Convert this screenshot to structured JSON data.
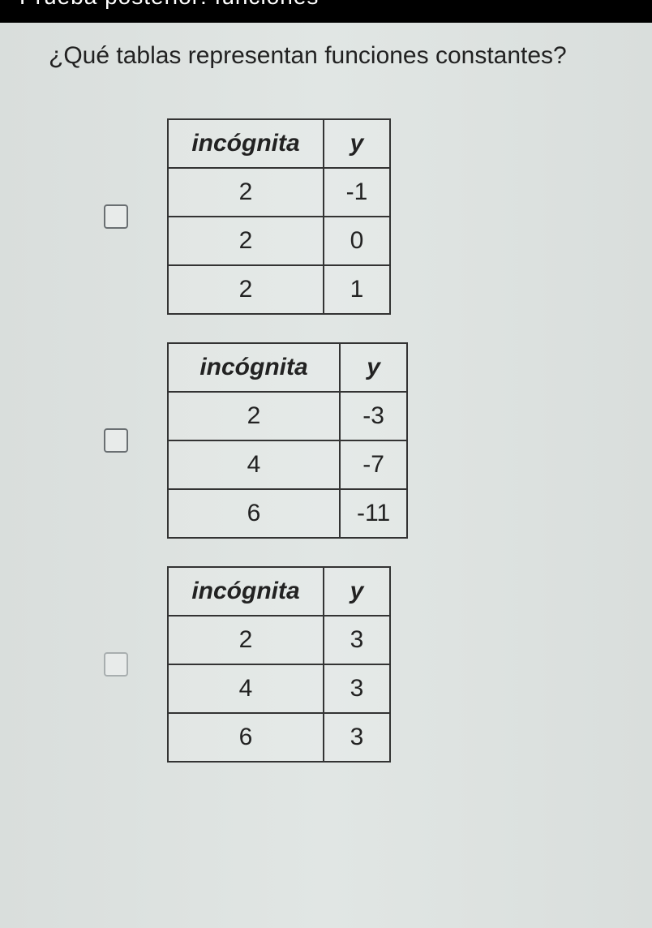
{
  "titlebar_partial": "Prueba posterior: funciones",
  "question": "¿Qué tablas representan funciones constantes?",
  "xheader": "incógnita",
  "yheader": "y",
  "tables": [
    {
      "rows": [
        {
          "x": "2",
          "y": "-1"
        },
        {
          "x": "2",
          "y": "0"
        },
        {
          "x": "2",
          "y": "1"
        }
      ]
    },
    {
      "rows": [
        {
          "x": "2",
          "y": "-3"
        },
        {
          "x": "4",
          "y": "-7"
        },
        {
          "x": "6",
          "y": "-11"
        }
      ]
    },
    {
      "rows": [
        {
          "x": "2",
          "y": "3"
        },
        {
          "x": "4",
          "y": "3"
        },
        {
          "x": "6",
          "y": "3"
        }
      ]
    }
  ]
}
